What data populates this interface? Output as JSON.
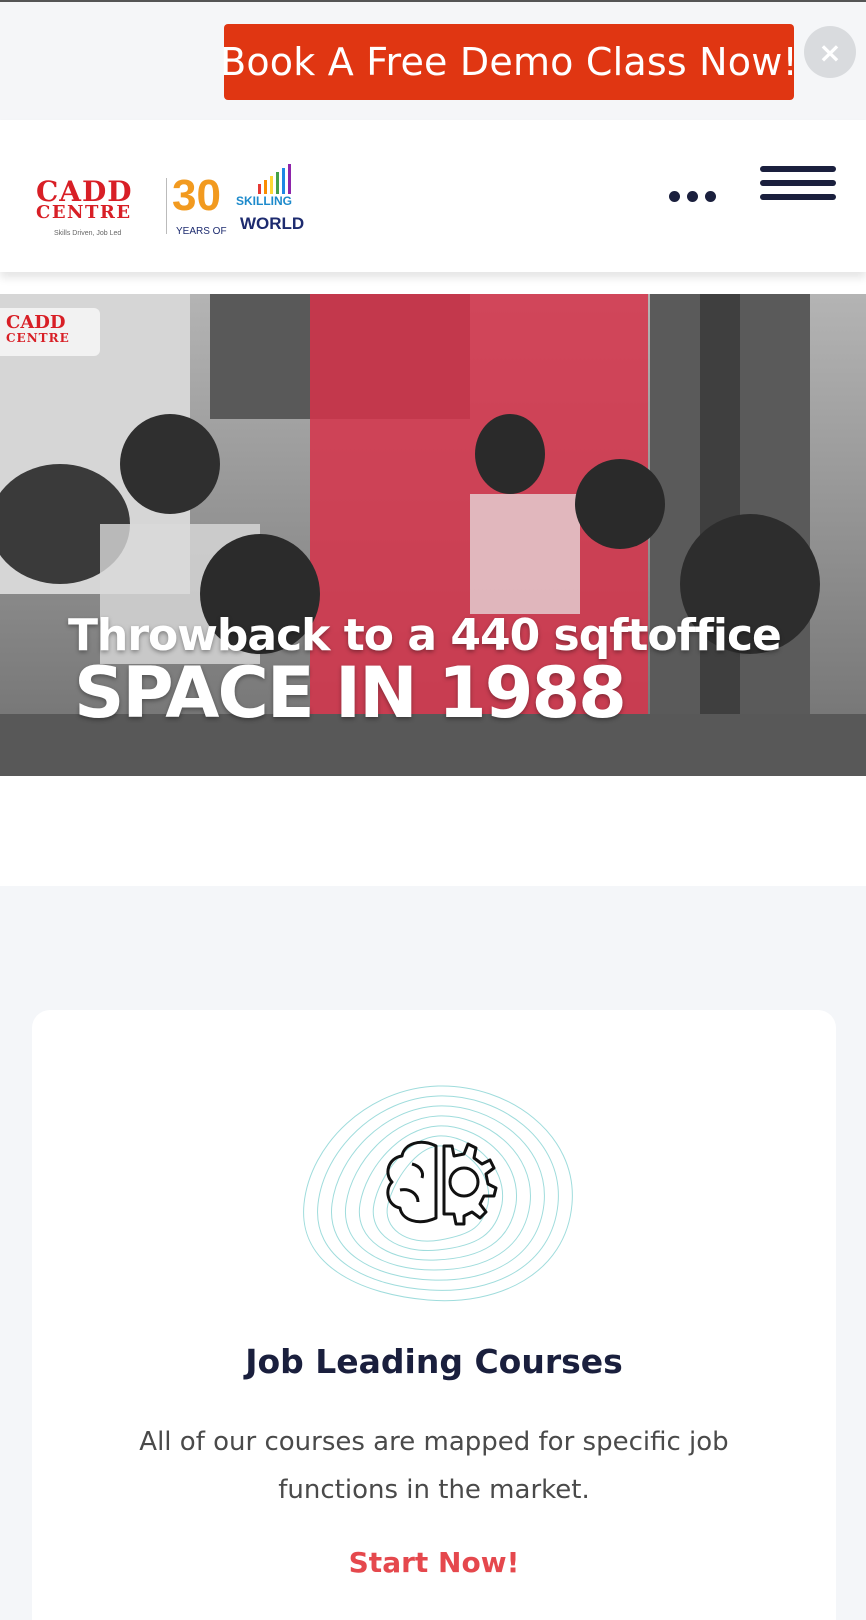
{
  "promo": {
    "cta_label": "Book A Free Demo Class Now!",
    "close_symbol": "×",
    "cta_color": "#e03612"
  },
  "header": {
    "logo": {
      "brand_line1": "CADD",
      "brand_line2": "CENTRE",
      "tagline": "Skills Driven, Job Led",
      "anniversary_number": "30",
      "anniversary_years": "YEARS OF",
      "anniversary_skilling": "SKILLING",
      "anniversary_world": "WORLD"
    },
    "more_icon": "more-dots-icon",
    "menu_icon": "hamburger-menu-icon"
  },
  "hero": {
    "badge_line1": "CADD",
    "badge_line2": "CENTRE",
    "caption_line1": "Throwback to a 440 sqftoffice",
    "caption_line2": "SPACE IN 1988",
    "highlight_color": "#d6324a"
  },
  "features": {
    "cards": [
      {
        "icon": "brain-gear-icon",
        "title": "Job Leading Courses",
        "description": "All of our courses are mapped for specific job functions in the market.",
        "link_label": "Start Now!"
      }
    ],
    "accent_color": "#e5484d"
  }
}
